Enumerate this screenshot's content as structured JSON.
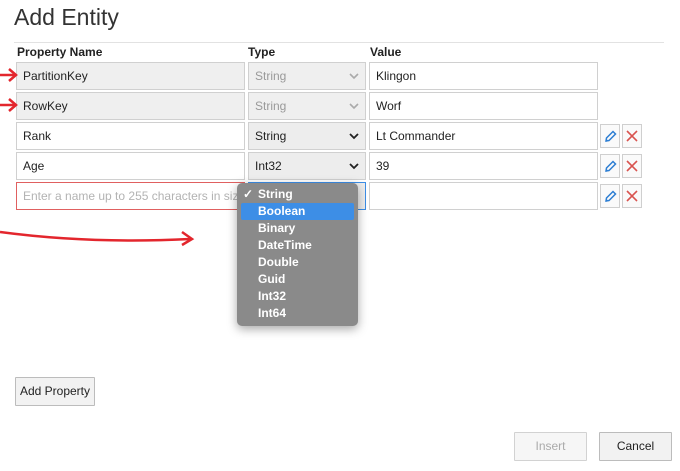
{
  "dialog": {
    "title": "Add Entity",
    "columns": {
      "name": "Property Name",
      "type": "Type",
      "value": "Value"
    }
  },
  "rows": [
    {
      "name": "PartitionKey",
      "type": "String",
      "value": "Klingon"
    },
    {
      "name": "RowKey",
      "type": "String",
      "value": "Worf"
    },
    {
      "name": "Rank",
      "type": "String",
      "value": "Lt Commander"
    },
    {
      "name": "Age",
      "type": "Int32",
      "value": "39"
    },
    {
      "name_placeholder": "Enter a name up to 255 characters in size",
      "type": "String",
      "value": ""
    }
  ],
  "type_dropdown": {
    "options": [
      "String",
      "Boolean",
      "Binary",
      "DateTime",
      "Double",
      "Guid",
      "Int32",
      "Int64"
    ],
    "checked": "String",
    "highlighted": "Boolean"
  },
  "buttons": {
    "add_property": "Add Property",
    "insert": "Insert",
    "cancel": "Cancel"
  },
  "colors": {
    "annotation_red": "#e3262d",
    "highlight_blue": "#3d8ee6",
    "edit_icon": "#2f7fd3",
    "delete_icon": "#d9534f"
  }
}
